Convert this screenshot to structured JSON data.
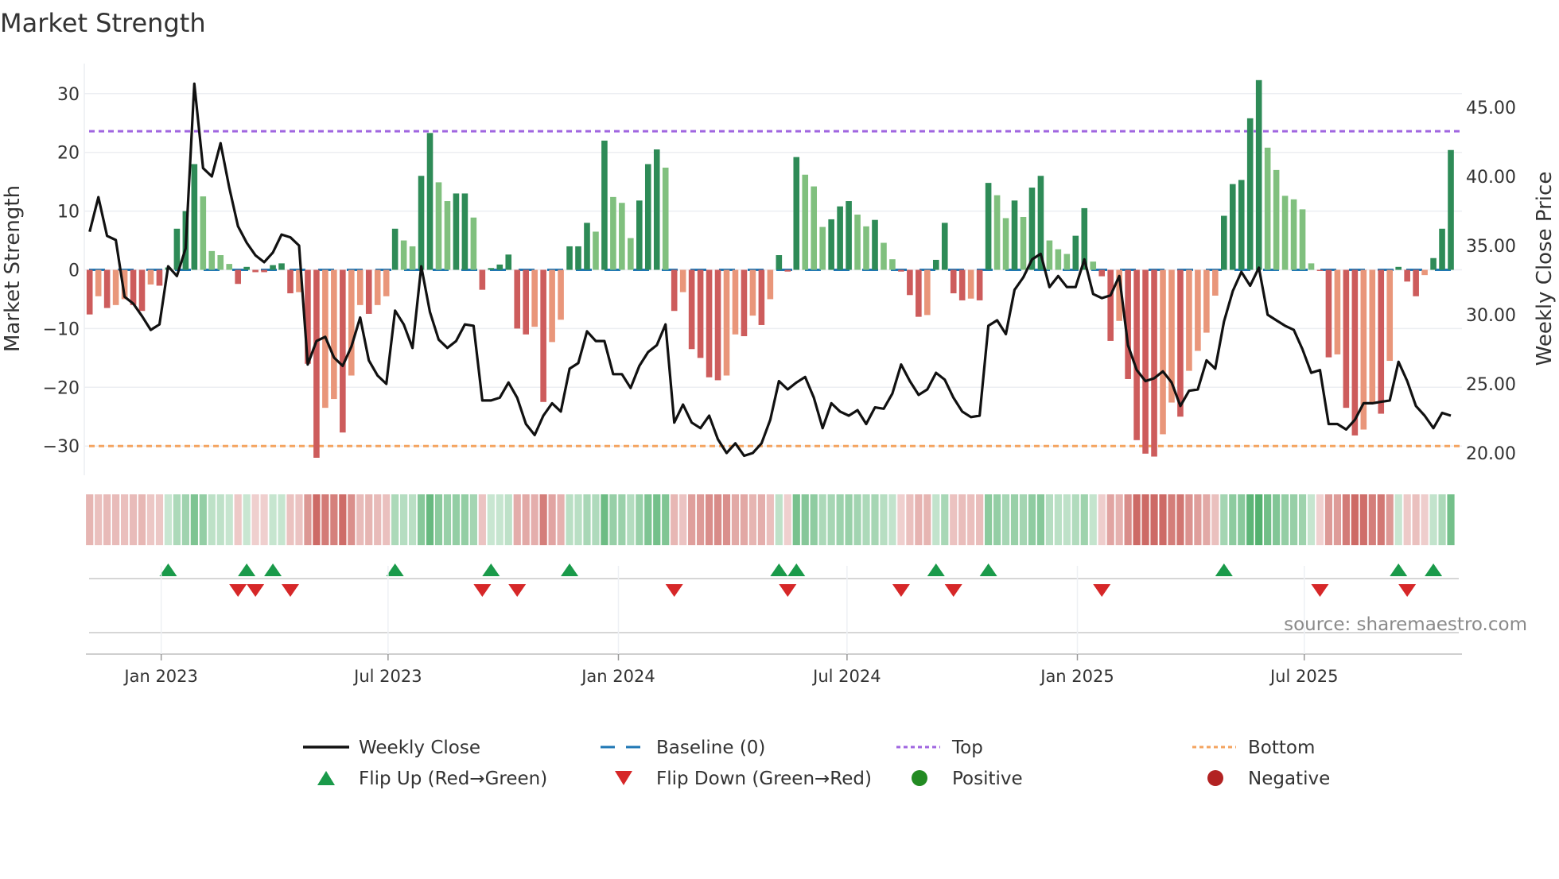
{
  "chart_data": {
    "type": "bar",
    "title": "Market Strength",
    "ylabel": "Market Strength",
    "y2label": "Weekly Close Price",
    "ylim": [
      -35,
      35
    ],
    "y2lim": [
      20,
      45
    ],
    "yticks": [
      30,
      20,
      10,
      0,
      -10,
      -20,
      -30
    ],
    "ytick_labels": [
      "30",
      "20",
      "10",
      "0",
      "−10",
      "−20",
      "−30"
    ],
    "y2ticks": [
      45,
      40,
      35,
      30,
      25,
      20
    ],
    "y2tick_labels": [
      "45.00",
      "40.00",
      "35.00",
      "30.00",
      "25.00",
      "20.00"
    ],
    "xticks": [
      {
        "label": "Jan 2023",
        "week": 8.2
      },
      {
        "label": "Jul 2023",
        "week": 34.2
      },
      {
        "label": "Jan 2024",
        "week": 60.6
      },
      {
        "label": "Jul 2024",
        "week": 86.8
      },
      {
        "label": "Jan 2025",
        "week": 113.2
      },
      {
        "label": "Jul 2025",
        "week": 139.2
      }
    ],
    "grid": true,
    "top_level": 23.6,
    "bottom_level": -30,
    "baseline": 0,
    "strength": [
      -7.6,
      -4.5,
      -6.5,
      -6,
      -5,
      -6,
      -7,
      -2.5,
      -2.7,
      0.4,
      7,
      10,
      18,
      12.5,
      3.2,
      2.5,
      1,
      -2.4,
      0.5,
      -0.4,
      -0.4,
      0.8,
      1.1,
      -4,
      -3.8,
      -16,
      -32,
      -23.5,
      -22,
      -27.7,
      -18,
      -6,
      -7.5,
      -6,
      -4.5,
      7,
      5,
      4,
      16,
      23.3,
      14.9,
      11.7,
      13,
      13,
      8.9,
      -3.4,
      0.3,
      0.9,
      2.6,
      -10,
      -11,
      -9.7,
      -22.5,
      -12.3,
      -8.5,
      4,
      4,
      8,
      6.5,
      22,
      12.4,
      11.4,
      5.4,
      11.8,
      18,
      20.5,
      17.4,
      -7,
      -3.8,
      -13.5,
      -15,
      -18.3,
      -18.8,
      -18,
      -11,
      -11.3,
      -7.8,
      -9.4,
      -5,
      2.5,
      -0.3,
      19.2,
      16.2,
      14.2,
      7.3,
      8.6,
      10.8,
      11.7,
      9.4,
      7.4,
      8.5,
      4.6,
      1.8,
      -0.3,
      -4.3,
      -8,
      -7.7,
      1.7,
      8,
      -4,
      -5.2,
      -4.9,
      -5.2,
      14.8,
      12.7,
      8.8,
      11.8,
      9,
      14,
      16,
      5,
      3.5,
      2.7,
      5.8,
      10.5,
      1.4,
      -1.1,
      -12.1,
      -8.7,
      -18.6,
      -29,
      -31.3,
      -31.8,
      -28,
      -22.6,
      -25,
      -17.2,
      -13.8,
      -10.7,
      -4.4,
      9.2,
      14.6,
      15.3,
      25.8,
      32.3,
      20.8,
      17,
      12.6,
      12,
      10.3,
      1.1,
      -0.2,
      -14.9,
      -14.4,
      -23.5,
      -28.2,
      -27.2,
      -22.6,
      -24.5,
      -15.5,
      0.5,
      -2,
      -4.5,
      -0.9,
      2,
      7,
      20.4
    ],
    "weekly_close": [
      36.0,
      38.5,
      35.7,
      35.4,
      31.3,
      30.8,
      29.9,
      28.9,
      29.3,
      33.5,
      32.8,
      34.8,
      46.7,
      40.6,
      40.0,
      42.4,
      39.2,
      36.4,
      35.2,
      34.3,
      33.8,
      34.5,
      35.8,
      35.6,
      35.0,
      26.4,
      28.1,
      28.4,
      26.9,
      26.3,
      27.7,
      29.8,
      26.7,
      25.6,
      25.0,
      30.3,
      29.3,
      27.6,
      33.5,
      30.2,
      28.2,
      27.6,
      28.1,
      29.3,
      29.2,
      23.8,
      23.8,
      24.0,
      25.1,
      24.0,
      22.1,
      21.3,
      22.7,
      23.6,
      23.0,
      26.1,
      26.5,
      28.8,
      28.1,
      28.1,
      25.7,
      25.7,
      24.7,
      26.3,
      27.3,
      27.8,
      29.3,
      22.2,
      23.5,
      22.2,
      21.8,
      22.7,
      21.0,
      20.0,
      20.7,
      19.8,
      20.0,
      20.7,
      22.4,
      25.2,
      24.6,
      25.1,
      25.5,
      24.0,
      21.8,
      23.6,
      23.0,
      22.7,
      23.1,
      22.1,
      23.3,
      23.2,
      24.3,
      26.4,
      25.2,
      24.2,
      24.6,
      25.8,
      25.3,
      24.0,
      23.0,
      22.6,
      22.7,
      29.2,
      29.6,
      28.6,
      31.8,
      32.7,
      34.0,
      34.4,
      32.0,
      32.8,
      32.0,
      32.0,
      34.0,
      31.5,
      31.2,
      31.4,
      32.8,
      27.8,
      26.0,
      25.2,
      25.4,
      25.9,
      25.1,
      23.4,
      24.5,
      24.6,
      26.7,
      26.1,
      29.5,
      31.7,
      33.1,
      32.1,
      33.4,
      30.0,
      29.6,
      29.2,
      28.9,
      27.5,
      25.8,
      26.0,
      22.1,
      22.1,
      21.7,
      22.4,
      23.6,
      23.6,
      23.7,
      23.8,
      26.6,
      25.2,
      23.4,
      22.7,
      21.8,
      22.9,
      22.7
    ],
    "legend": {
      "placement": "bottom",
      "items": [
        {
          "label": "Weekly Close",
          "kind": "line"
        },
        {
          "label": "Baseline (0)",
          "kind": "dash"
        },
        {
          "label": "Top",
          "kind": "dot"
        },
        {
          "label": "Bottom",
          "kind": "dot"
        },
        {
          "label": "Flip Up (Red→Green)",
          "kind": "up"
        },
        {
          "label": "Flip Down (Green→Red)",
          "kind": "down"
        },
        {
          "label": "Positive",
          "kind": "circle"
        },
        {
          "label": "Negative",
          "kind": "circle"
        }
      ]
    },
    "source": "source: sharemaestro.com"
  },
  "colors": {
    "dark_green": "#2e8b57",
    "light_green": "#80c07e",
    "dark_red": "#cd5c5c",
    "light_red": "#e9967a",
    "top": "#a066e0",
    "bottom": "#f4a460",
    "baseline": "#1f77b4",
    "line": "#111111",
    "flip_up": "#1a9a4a",
    "flip_down": "#d62728",
    "positive": "#228b22",
    "negative": "#b22222"
  }
}
